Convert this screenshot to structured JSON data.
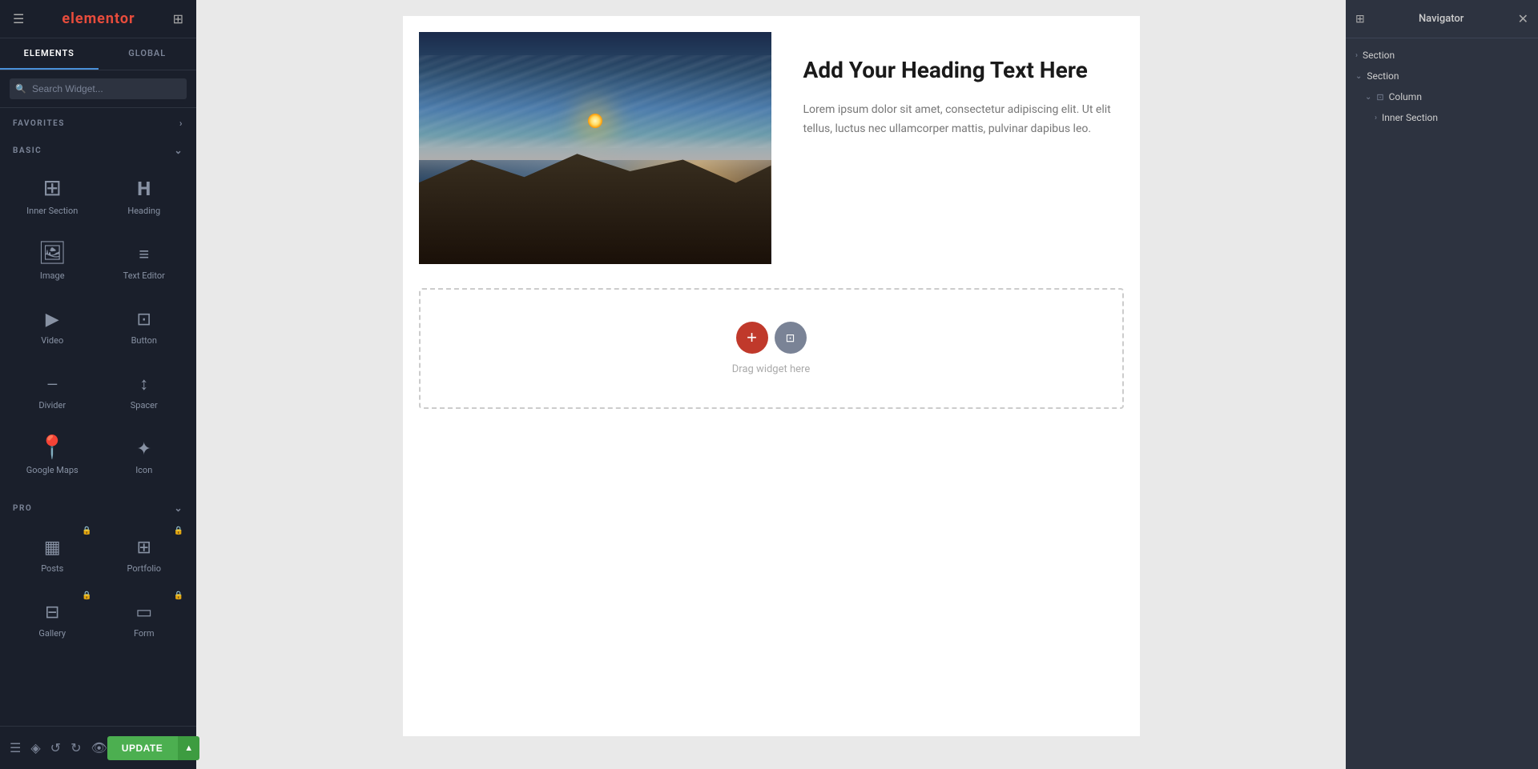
{
  "app": {
    "title": "elementor",
    "logo": "elementor"
  },
  "sidebar": {
    "tabs": [
      {
        "id": "elements",
        "label": "ELEMENTS",
        "active": true
      },
      {
        "id": "global",
        "label": "GLOBAL",
        "active": false
      }
    ],
    "search_placeholder": "Search Widget...",
    "sections": {
      "favorites": {
        "label": "FAVORITES",
        "collapsed": false
      },
      "basic": {
        "label": "BASIC",
        "collapsed": false,
        "widgets": [
          {
            "id": "inner-section",
            "label": "Inner Section",
            "icon": "inner-section"
          },
          {
            "id": "heading",
            "label": "Heading",
            "icon": "heading"
          },
          {
            "id": "image",
            "label": "Image",
            "icon": "image"
          },
          {
            "id": "text-editor",
            "label": "Text Editor",
            "icon": "text-editor"
          },
          {
            "id": "video",
            "label": "Video",
            "icon": "video"
          },
          {
            "id": "button",
            "label": "Button",
            "icon": "button"
          },
          {
            "id": "divider",
            "label": "Divider",
            "icon": "divider"
          },
          {
            "id": "spacer",
            "label": "Spacer",
            "icon": "spacer"
          },
          {
            "id": "google-maps",
            "label": "Google Maps",
            "icon": "google-maps"
          },
          {
            "id": "icon",
            "label": "Icon",
            "icon": "icon"
          }
        ]
      },
      "pro": {
        "label": "PRO",
        "collapsed": false,
        "widgets": [
          {
            "id": "posts",
            "label": "Posts",
            "icon": "posts",
            "pro": true
          },
          {
            "id": "portfolio",
            "label": "Portfolio",
            "icon": "portfolio",
            "pro": true
          },
          {
            "id": "gallery",
            "label": "Gallery",
            "icon": "gallery",
            "pro": true
          },
          {
            "id": "form",
            "label": "Form",
            "icon": "form",
            "pro": true
          }
        ]
      }
    },
    "footer": {
      "update_label": "UPDATE"
    }
  },
  "canvas": {
    "heading": "Add Your Heading Text Here",
    "paragraph": "Lorem ipsum dolor sit amet, consectetur adipiscing elit. Ut elit tellus, luctus nec ullamcorper mattis, pulvinar dapibus leo.",
    "drag_widget_label": "Drag widget here"
  },
  "navigator": {
    "title": "Navigator",
    "tree": [
      {
        "id": "section-1",
        "label": "Section",
        "indent": 0,
        "has_arrow": true,
        "expanded": false,
        "icon": "section"
      },
      {
        "id": "section-2",
        "label": "Section",
        "indent": 0,
        "has_arrow": true,
        "expanded": true,
        "icon": "section"
      },
      {
        "id": "column-1",
        "label": "Column",
        "indent": 1,
        "has_arrow": true,
        "expanded": true,
        "icon": "column"
      },
      {
        "id": "inner-section-1",
        "label": "Inner Section",
        "indent": 2,
        "has_arrow": true,
        "expanded": false,
        "icon": "inner-section"
      }
    ]
  }
}
